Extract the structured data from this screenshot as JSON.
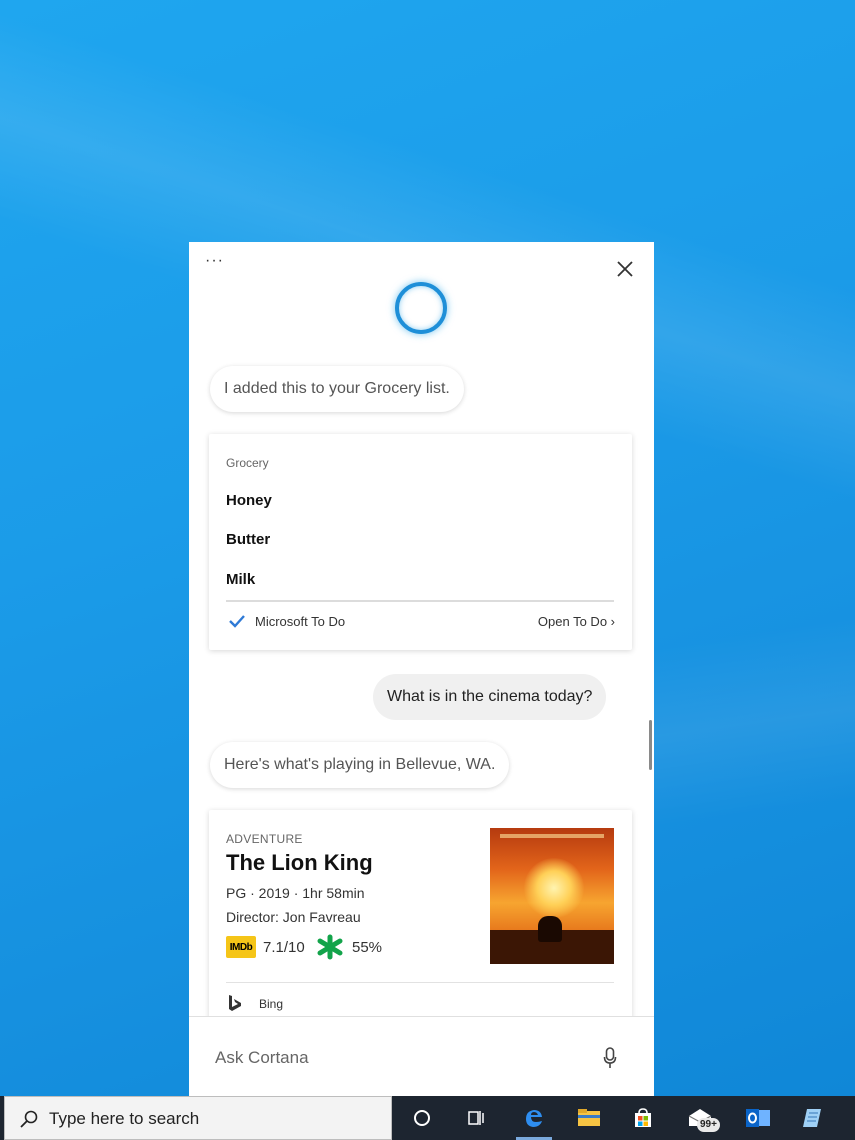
{
  "cortana": {
    "more_label": "···",
    "messages": {
      "grocery_reply": "I added this to your Grocery list.",
      "user_query": "What is in the cinema today?",
      "cinema_reply": "Here's what's playing in Bellevue, WA."
    },
    "todo_card": {
      "list_title": "Grocery",
      "items": [
        "Honey",
        "Butter",
        "Milk"
      ],
      "app_name": "Microsoft To Do",
      "open_link": "Open To Do ›"
    },
    "movie_card": {
      "genre": "ADVENTURE",
      "title": "The Lion King",
      "details": "PG · 2019 · 1hr 58min",
      "director": "Director: Jon Favreau",
      "imdb_label": "IMDb",
      "imdb_score": "7.1/10",
      "rt_score": "55%",
      "source": "Bing"
    },
    "ask_placeholder": "Ask Cortana"
  },
  "taskbar": {
    "search_placeholder": "Type here to search",
    "mail_badge": "99+"
  },
  "colors": {
    "accent": "#1e8fd8",
    "imdb": "#f5c518",
    "rotten_tomatoes": "#12a34a",
    "taskbar": "#1d2530"
  },
  "icons": [
    "more-icon",
    "close-icon",
    "cortana-ring-icon",
    "check-icon",
    "imdb-icon",
    "rotten-tomatoes-icon",
    "bing-icon",
    "microphone-icon",
    "search-icon",
    "cortana-icon",
    "task-view-icon",
    "edge-icon",
    "file-explorer-icon",
    "store-icon",
    "mail-icon",
    "outlook-icon",
    "notepad-icon"
  ]
}
